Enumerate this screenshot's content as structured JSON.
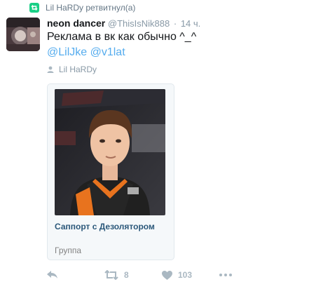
{
  "retweet_context": {
    "text": "Lil HaRDy ретвитнул(а)"
  },
  "tweet": {
    "fullname": "neon dancer",
    "handle": "@ThisIsNik888",
    "separator": "·",
    "time": "14 ч.",
    "text": "Реклама в вк как обычно ^_^",
    "mentions": [
      "@LilJke",
      "@v1lat"
    ],
    "tagged_user": "Lil HaRDy"
  },
  "card": {
    "title": "Саппорт с Дезолятором",
    "subtitle": "Группа"
  },
  "actions": {
    "reply_icon": "reply-icon",
    "retweet_count": "8",
    "like_count": "103",
    "more_icon": "more-icon"
  },
  "colors": {
    "link": "#1b95e0",
    "retweet_green": "#19cf86",
    "muted": "#8899a6",
    "icon": "#aab8c2",
    "card_title": "#2b587a"
  }
}
